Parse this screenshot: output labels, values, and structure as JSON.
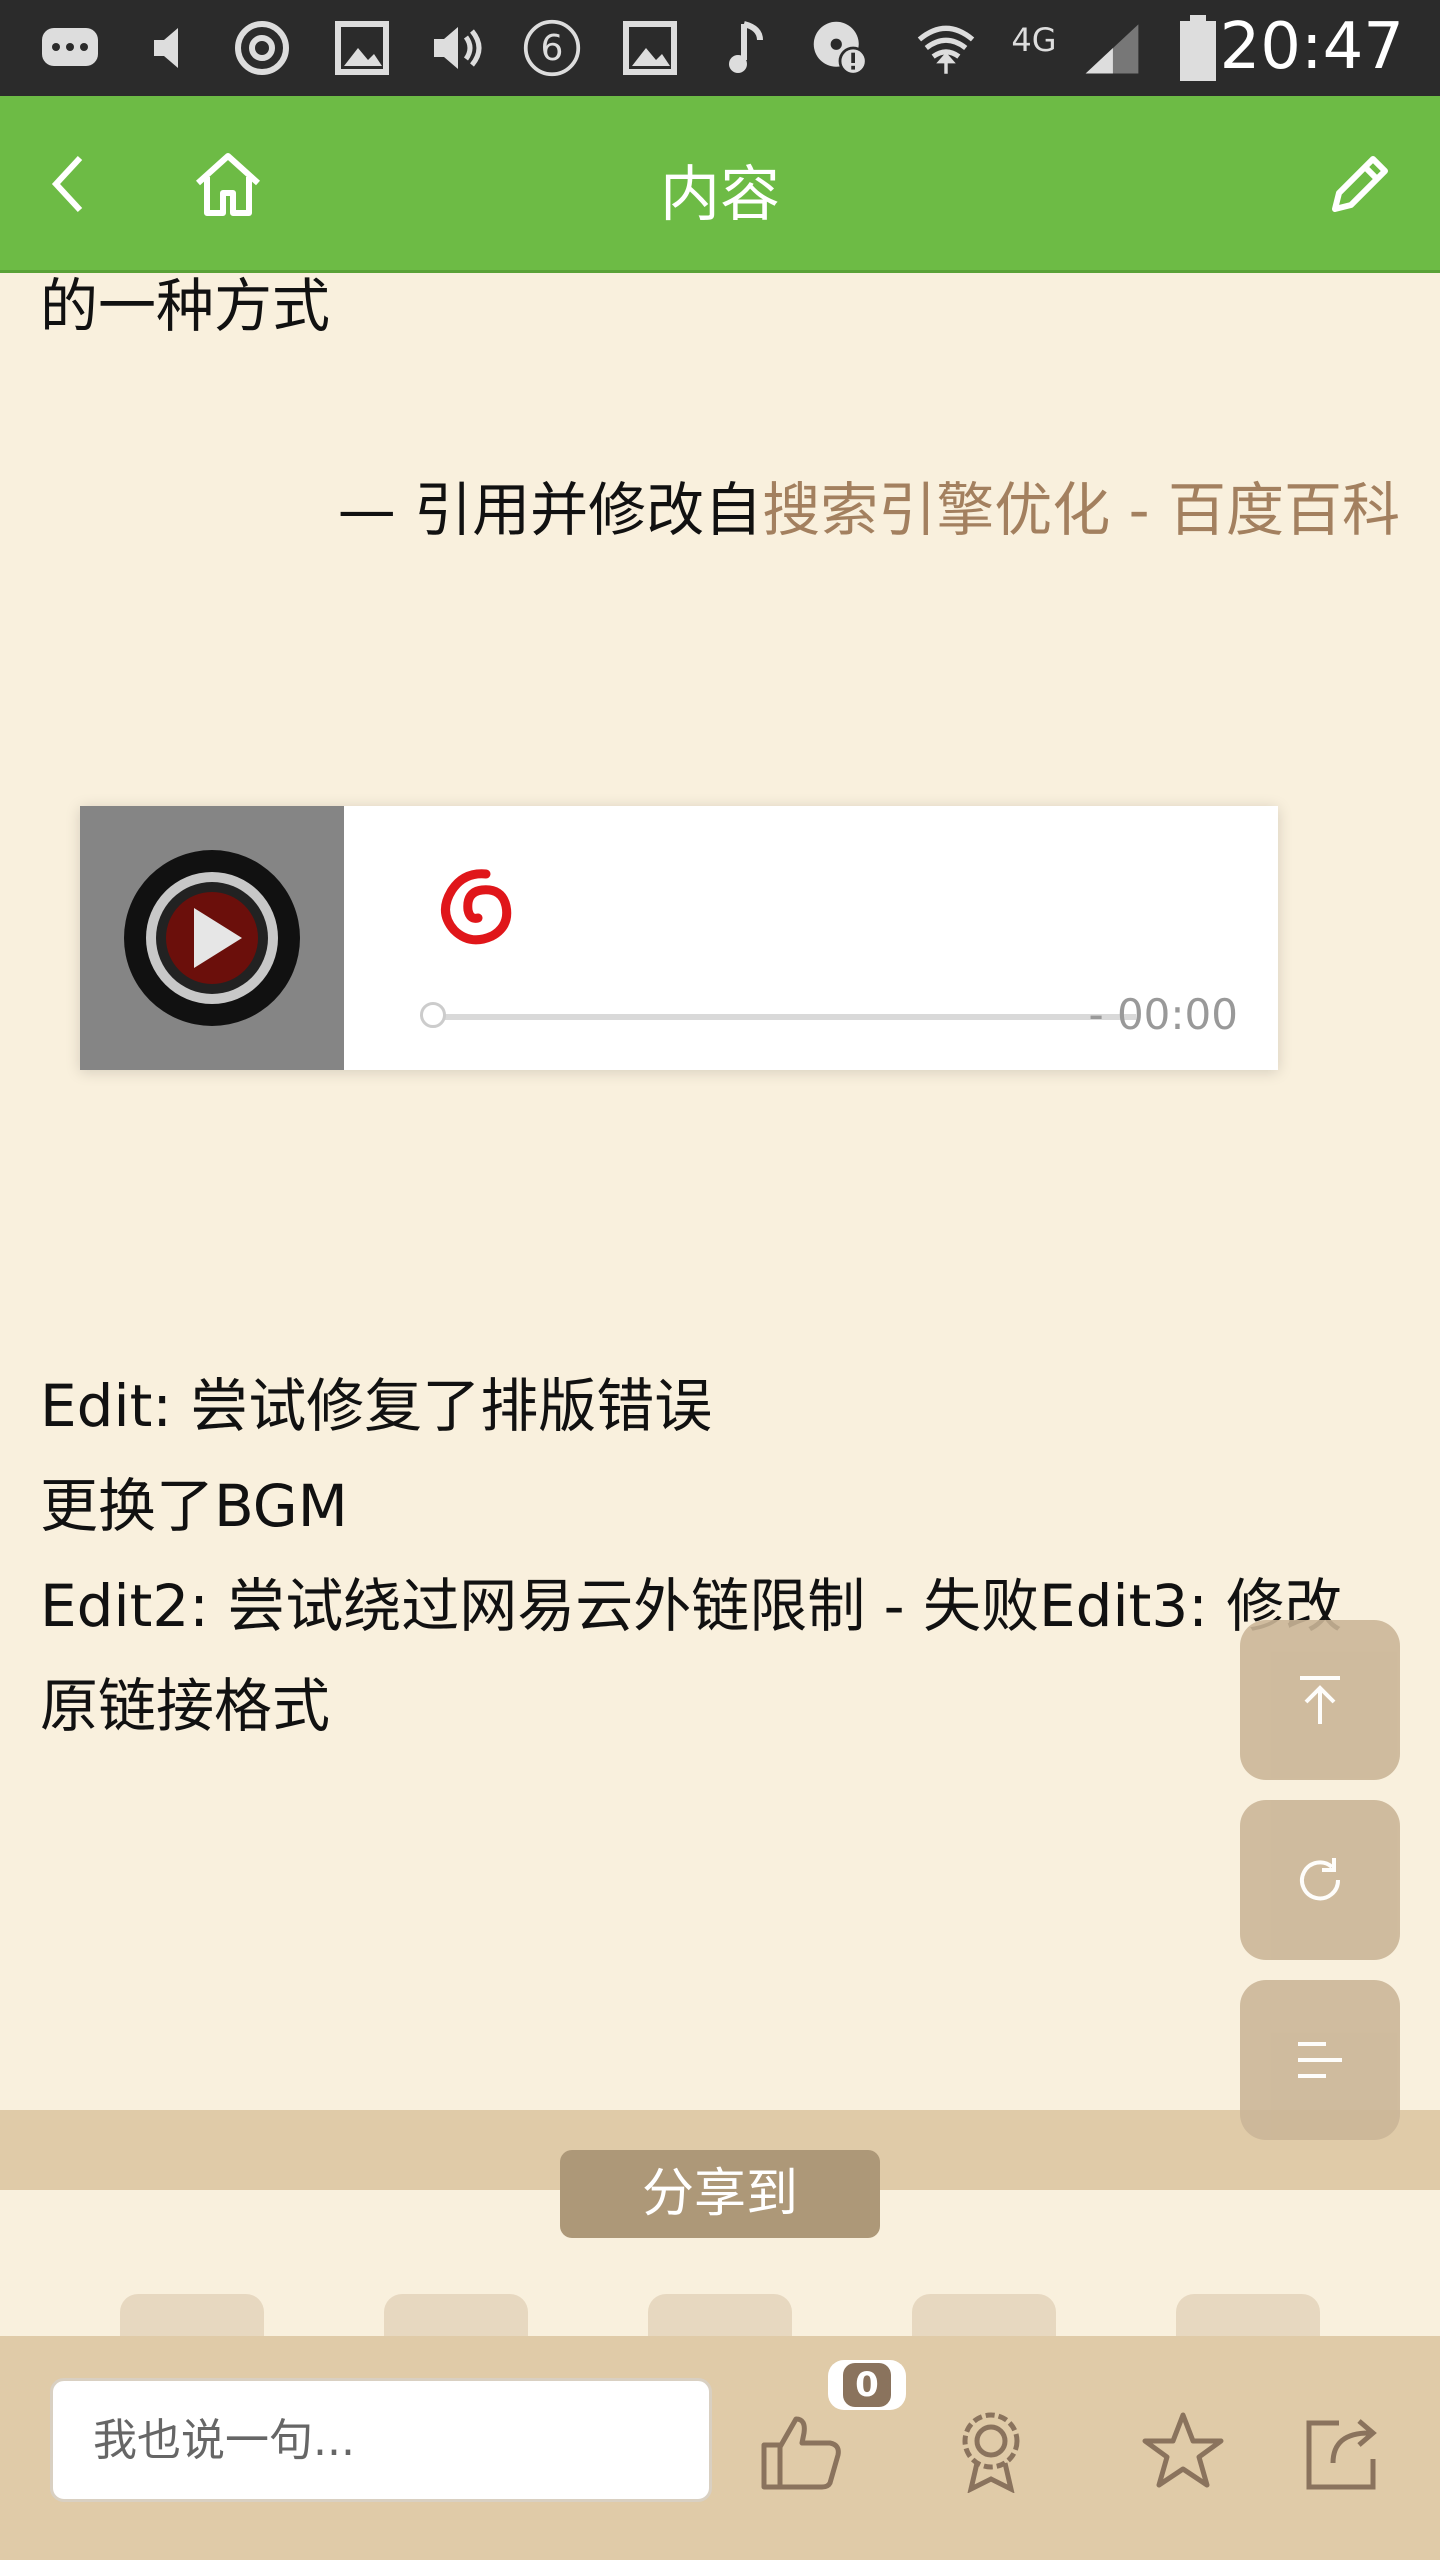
{
  "status_bar": {
    "time": "20:47",
    "network": "4G",
    "notification_count": "6",
    "icons": [
      "chat-icon",
      "mute-icon",
      "sync-icon",
      "image-icon",
      "volume-icon",
      "notification-count-icon",
      "image-icon",
      "music-note-icon",
      "alert-icon",
      "wifi-icon",
      "signal-icon",
      "battery-icon"
    ]
  },
  "appbar": {
    "title": "内容",
    "back_icon": "back-chevron-icon",
    "home_icon": "home-icon",
    "edit_icon": "edit-pencil-icon",
    "color": "#6dbb45"
  },
  "article": {
    "fragment": "的一种方式",
    "citation_prefix": "— 引用并修改自",
    "citation_link": "搜索引擎优化 - 百度百科",
    "edit_lines": [
      "Edit: 尝试修复了排版错误",
      "更换了BGM",
      "Edit2: 尝试绕过网易云外链限制 - 失败Edit3: 修改",
      "原链接格式"
    ]
  },
  "player": {
    "time_remaining": "- 00:00",
    "progress": 0,
    "logo_icon": "netease-cloud-music-icon",
    "play_icon": "play-icon"
  },
  "fabs": [
    "scroll-top-icon",
    "refresh-icon",
    "menu-icon"
  ],
  "share": {
    "label": "分享到"
  },
  "bottom_bar": {
    "comment_placeholder": "我也说一句...",
    "like_count": "0",
    "icons": [
      "thumbs-up-icon",
      "award-icon",
      "star-icon",
      "share-icon"
    ]
  },
  "colors": {
    "background": "#f9f0dd",
    "accent": "#6dbb45",
    "link": "#a3805f",
    "bar": "#e0cba8"
  }
}
